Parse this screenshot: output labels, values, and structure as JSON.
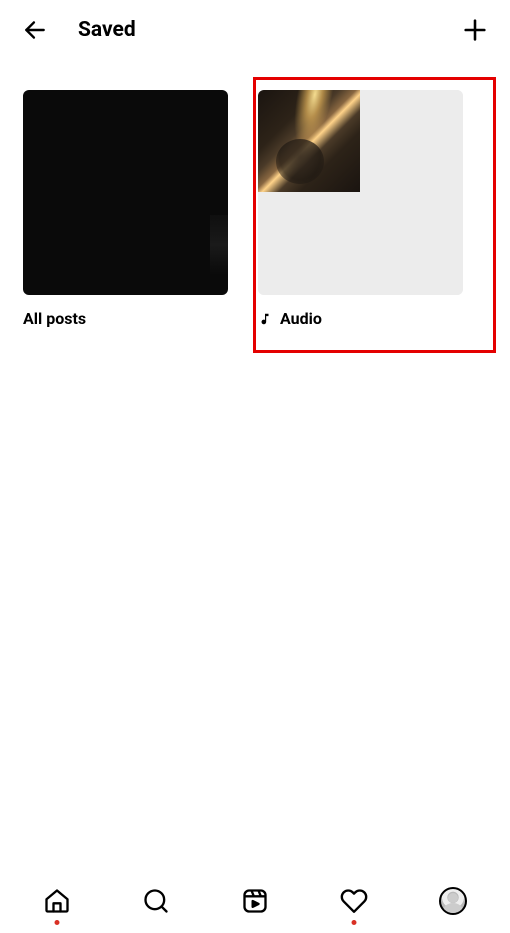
{
  "header": {
    "title": "Saved"
  },
  "collections": [
    {
      "label": "All posts",
      "has_icon": false
    },
    {
      "label": "Audio",
      "has_icon": true
    }
  ],
  "highlight": {
    "target": "audio-collection",
    "color": "#e40000"
  },
  "nav": {
    "home_has_dot": true,
    "activity_has_dot": true
  }
}
